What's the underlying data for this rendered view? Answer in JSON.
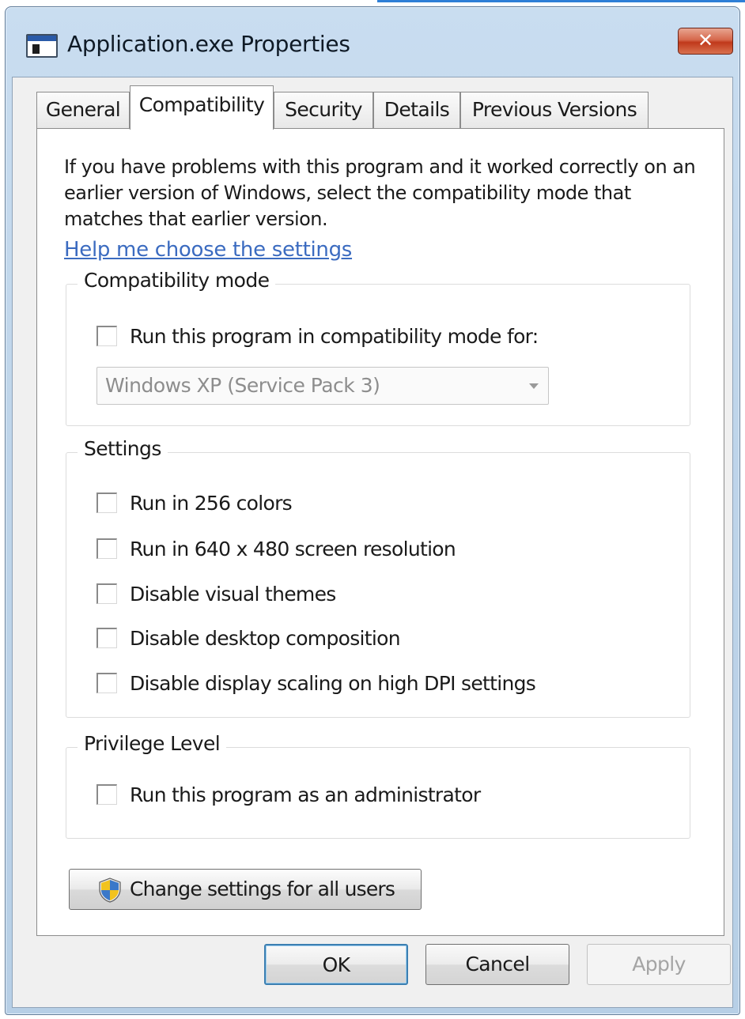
{
  "window": {
    "title": "Application.exe Properties",
    "close_glyph": "✕",
    "icon": "application-window-icon"
  },
  "tabs": [
    {
      "label": "General",
      "active": false
    },
    {
      "label": "Compatibility",
      "active": true
    },
    {
      "label": "Security",
      "active": false
    },
    {
      "label": "Details",
      "active": false
    },
    {
      "label": "Previous Versions",
      "active": false
    }
  ],
  "intro": {
    "text": "If you have problems with this program and it worked correctly on an earlier version of Windows, select the compatibility mode that matches that earlier version.",
    "help_link": "Help me choose the settings"
  },
  "compat_mode": {
    "label": "Compatibility mode",
    "checkbox_label": "Run this program in compatibility mode for:",
    "checked": false,
    "selected_os": "Windows XP (Service Pack 3)"
  },
  "settings": {
    "label": "Settings",
    "options": [
      {
        "label": "Run in 256 colors",
        "checked": false
      },
      {
        "label": "Run in 640 x 480 screen resolution",
        "checked": false
      },
      {
        "label": "Disable visual themes",
        "checked": false
      },
      {
        "label": "Disable desktop composition",
        "checked": false
      },
      {
        "label": "Disable display scaling on high DPI settings",
        "checked": false
      }
    ]
  },
  "privilege": {
    "label": "Privilege Level",
    "checkbox_label": "Run this program as an administrator",
    "checked": false
  },
  "change_all_users": {
    "label": "Change settings for all users",
    "icon": "uac-shield-icon"
  },
  "buttons": {
    "ok": "OK",
    "cancel": "Cancel",
    "apply": "Apply"
  },
  "colors": {
    "link": "#3b6bc0",
    "frame": "#c9ddf0",
    "close": "#c0391b"
  }
}
